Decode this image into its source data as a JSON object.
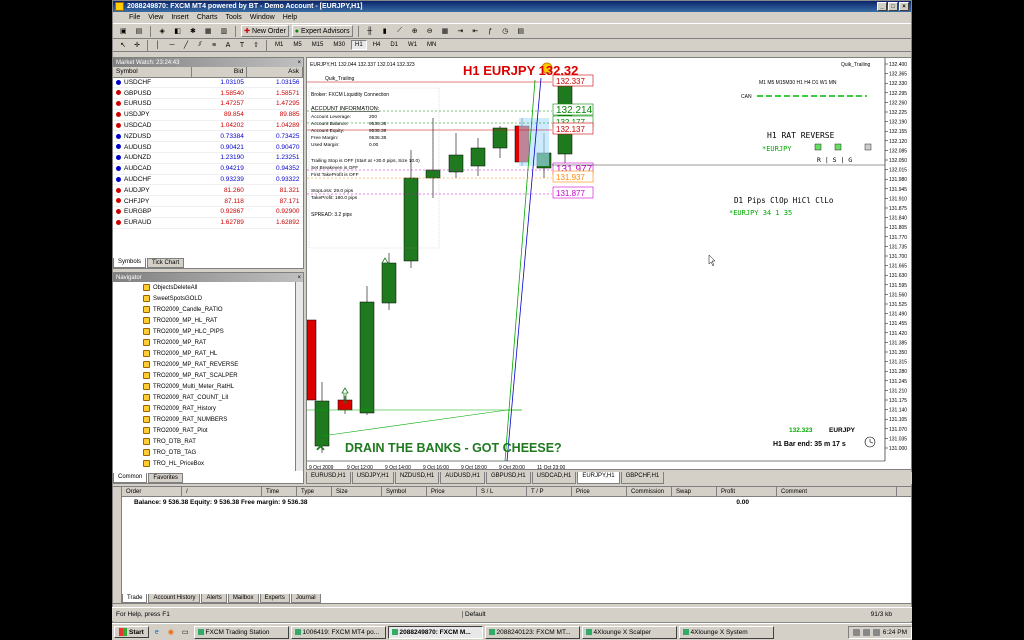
{
  "window": {
    "title": "2088249870: FXCM MT4 powered by BT - Demo Account - [EURJPY,H1]",
    "controls": [
      "_",
      "□",
      "×"
    ]
  },
  "menu": [
    "File",
    "View",
    "Insert",
    "Charts",
    "Tools",
    "Window",
    "Help"
  ],
  "toolbar": {
    "new_order": "New Order",
    "expert_advisors": "Expert Advisors",
    "timeframes": [
      "M1",
      "M5",
      "M15",
      "M30",
      "H1",
      "H4",
      "D1",
      "W1",
      "MN"
    ],
    "active_timeframe": "H1"
  },
  "market_watch": {
    "title": "Market Watch: 23:24:43",
    "columns": [
      "Symbol",
      "Bid",
      "Ask"
    ],
    "rows": [
      {
        "symbol": "USDCHF",
        "bid": "1.03105",
        "ask": "1.03156",
        "color": "#0000cc"
      },
      {
        "symbol": "GBPUSD",
        "bid": "1.58540",
        "ask": "1.58571",
        "color": "#cc0000"
      },
      {
        "symbol": "EURUSD",
        "bid": "1.47257",
        "ask": "1.47295",
        "color": "#cc0000"
      },
      {
        "symbol": "USDJPY",
        "bid": "89.854",
        "ask": "89.885",
        "color": "#cc0000"
      },
      {
        "symbol": "USDCAD",
        "bid": "1.04202",
        "ask": "1.04289",
        "color": "#cc0000"
      },
      {
        "symbol": "NZDUSD",
        "bid": "0.73384",
        "ask": "0.73425",
        "color": "#0000cc"
      },
      {
        "symbol": "AUDUSD",
        "bid": "0.90421",
        "ask": "0.90470",
        "color": "#0000cc"
      },
      {
        "symbol": "AUDNZD",
        "bid": "1.23190",
        "ask": "1.23251",
        "color": "#0000cc"
      },
      {
        "symbol": "AUDCAD",
        "bid": "0.94219",
        "ask": "0.94352",
        "color": "#0000cc"
      },
      {
        "symbol": "AUDCHF",
        "bid": "0.93239",
        "ask": "0.93322",
        "color": "#0000cc"
      },
      {
        "symbol": "AUDJPY",
        "bid": "81.260",
        "ask": "81.321",
        "color": "#cc0000"
      },
      {
        "symbol": "CHFJPY",
        "bid": "87.118",
        "ask": "87.171",
        "color": "#cc0000"
      },
      {
        "symbol": "EURGBP",
        "bid": "0.92867",
        "ask": "0.92900",
        "color": "#cc0000"
      },
      {
        "symbol": "EURAUD",
        "bid": "1.62789",
        "ask": "1.62892",
        "color": "#cc0000"
      }
    ],
    "tabs": [
      "Symbols",
      "Tick Chart"
    ]
  },
  "navigator": {
    "title": "Navigator",
    "items": [
      "ObjectsDeleteAll",
      "SweetSpotsGOLD",
      "TRO2009_Candle_RATIO",
      "TRO2009_MP_HL_RAT",
      "TRO2009_MP_HLC_PIPS",
      "TRO2009_MP_RAT",
      "TRO2009_MP_RAT_HL",
      "TRO2009_MP_RAT_REVERSE",
      "TRO2009_MP_RAT_SCALPER",
      "TRO2009_Multi_Meter_RatHL",
      "TRO2009_RAT_COUNT_LII",
      "TRO2009_RAT_History",
      "TRO2009_RAT_NUMBERS",
      "TRO2009_RAT_Plot",
      "TRO_DTB_RAT",
      "TRO_DTB_TAG",
      "TRO_HL_PriceBox"
    ],
    "tabs": [
      "Common",
      "Favorites"
    ]
  },
  "chart": {
    "header": "EURJPY,H1  132.044 132.337 132.014 132.323",
    "indicator_name": "Quik_Trailing",
    "big_title": "H1 EURJPY 132.32",
    "broker": "Broker:  FXCM Liquidity Connection",
    "account_info_title": "ACCOUNT INFORMATION:",
    "account_rows": [
      {
        "label": "Account Leverage:",
        "value": "200"
      },
      {
        "label": "Account Balance:",
        "value": "9536.38"
      },
      {
        "label": "Account Equity:",
        "value": "9536.38"
      },
      {
        "label": "Free Margin:",
        "value": "9536.38"
      },
      {
        "label": "Used Margin:",
        "value": "0.00"
      }
    ],
    "trailing_lines": [
      "Trailing Stop is OFF (Start at +30.0 pips, Size 10.0)",
      "Set Breakeven is OFF",
      "First TakeProfit is OFF"
    ],
    "sl_tp": [
      "StopLoss: 29.0 pips",
      "TakeProfit: 180.0 pips"
    ],
    "spread": "SPREAD:  3.2  pips",
    "rat_header": "M1 M5 M15M30  H1  H4  D1  W1 MN",
    "can_label": "CAN",
    "rat_reverse": "H1 RAT REVERSE",
    "rat_sym": "*EURJPY",
    "rsg": "R   |   S   |   G",
    "d1_header": "D1  Pips  ClOp  HiCl  ClLo",
    "d1_row": "*EURJPY      34      1     35",
    "price_labels": [
      {
        "text": "132.337",
        "color": "#cc0000"
      },
      {
        "text": "132.214",
        "color": "#008800"
      },
      {
        "text": "132.177",
        "color": "#008800"
      },
      {
        "text": "132.137",
        "color": "#cc0000"
      },
      {
        "text": "131.977",
        "color": "#cc00cc"
      },
      {
        "text": "131.937",
        "color": "#ff8800"
      },
      {
        "text": "131.877",
        "color": "#cc00cc"
      }
    ],
    "slogan": "DRAIN THE BANKS - GOT CHEESE?",
    "current_price": "132.323",
    "symbol": "EURJPY",
    "bar_end": "H1 Bar end: 35 m 17 s",
    "y_ticks": [
      "132.400",
      "132.365",
      "132.330",
      "132.295",
      "132.260",
      "132.225",
      "132.190",
      "132.155",
      "132.120",
      "132.085",
      "132.050",
      "132.015",
      "131.980",
      "131.945",
      "131.910",
      "131.875",
      "131.840",
      "131.805",
      "131.770",
      "131.735",
      "131.700",
      "131.665",
      "131.630",
      "131.595",
      "131.560",
      "131.525",
      "131.490",
      "131.455",
      "131.420",
      "131.385",
      "131.350",
      "131.315",
      "131.280",
      "131.245",
      "131.210",
      "131.175",
      "131.140",
      "131.105",
      "131.070",
      "131.035",
      "131.000"
    ],
    "x_ticks": [
      "9 Oct 2009",
      "9 Oct 12:00",
      "9 Oct 14:00",
      "9 Oct 16:00",
      "9 Oct 18:00",
      "9 Oct 20:00",
      "11 Oct 23:00"
    ]
  },
  "chart_tabs": [
    "EURUSD,H1",
    "USDJPY,H1",
    "NZDUSD,H1",
    "AUDUSD,H1",
    "GBPUSD,H1",
    "USDCAD,H1",
    "EURJPY,H1",
    "GBPCHF,H1"
  ],
  "active_chart_tab": "EURJPY,H1",
  "terminal": {
    "columns": [
      "Order",
      "/",
      "Time",
      "Type",
      "Size",
      "Symbol",
      "Price",
      "S / L",
      "T / P",
      "Price",
      "Commission",
      "Swap",
      "Profit",
      "Comment"
    ],
    "balance_line": "Balance: 9 536.38  Equity: 9 536.38  Free margin: 9 536.38",
    "profit": "0.00",
    "tabs": [
      "Trade",
      "Account History",
      "Alerts",
      "Mailbox",
      "Experts",
      "Journal"
    ]
  },
  "status": {
    "help": "For Help, press F1",
    "profile": "Default",
    "traffic": "91/3 kb"
  },
  "taskbar": {
    "start": "Start",
    "tasks": [
      "FXCM Trading Station",
      "1006419: FXCM MT4 po...",
      "2088249870: FXCM M...",
      "2088240123: FXCM MT...",
      "4Xlounge X Scalper",
      "4Xlounge X System"
    ],
    "active_task": 2,
    "clock": "6:24 PM"
  }
}
